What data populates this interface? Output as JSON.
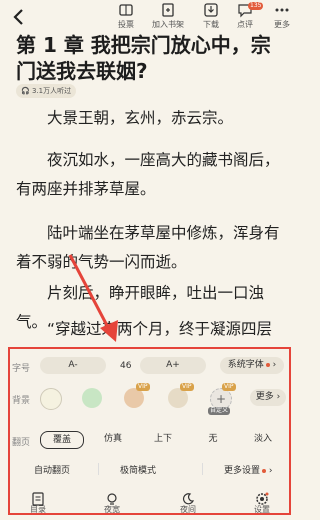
{
  "toolbar": {
    "back_icon": "chevron-left-icon",
    "items": [
      {
        "label": "投票",
        "icon": "ticket-icon"
      },
      {
        "label": "加入书架",
        "icon": "bookshelf-icon"
      },
      {
        "label": "下载",
        "icon": "download-icon"
      },
      {
        "label": "点评",
        "icon": "comment-icon",
        "badge": "135"
      },
      {
        "label": "更多",
        "icon": "more-icon"
      }
    ]
  },
  "chapter": {
    "title": "第 1 章  我把宗门放心中，宗门送我去联姻?",
    "listeners": "3.1万人听过",
    "paragraphs": [
      "大景王朝，玄州，赤云宗。",
      "夜沉如水，一座高大的藏书阁后，有两座并排茅草屋。",
      "陆叶端坐在茅草屋中修炼，浑身有着不弱的气势一闪而逝。",
      "片刻后，睁开眼眸，吐出一口浊气。",
      "“穿越过来两个月，终于凝源四层"
    ]
  },
  "settings": {
    "font": {
      "label": "字号",
      "decrease": "A-",
      "size": "46",
      "increase": "A+",
      "system_font": "系统字体"
    },
    "background": {
      "label": "背景",
      "swatches": [
        "#f5f2e0",
        "#c8e6c4",
        "#e9c9a8",
        "#e6dbc6",
        "#eae6e0"
      ],
      "vip_tag": "VIP",
      "custom_tag": "自定义",
      "more": "更多"
    },
    "flip": {
      "label": "翻页",
      "options": [
        "覆盖",
        "仿真",
        "上下",
        "无",
        "淡入"
      ],
      "selected": "覆盖"
    },
    "extras": [
      "自动翻页",
      "极简模式",
      "更多设置"
    ],
    "nav": [
      {
        "label": "目录",
        "icon": "catalog-icon"
      },
      {
        "label": "夜宽",
        "icon": "bulb-icon"
      },
      {
        "label": "夜间",
        "icon": "moon-icon"
      },
      {
        "label": "设置",
        "icon": "gear-icon"
      }
    ]
  },
  "colors": {
    "accent": "#e25b3a",
    "highlight_border": "#e5443a",
    "arrow": "#e5443a"
  }
}
